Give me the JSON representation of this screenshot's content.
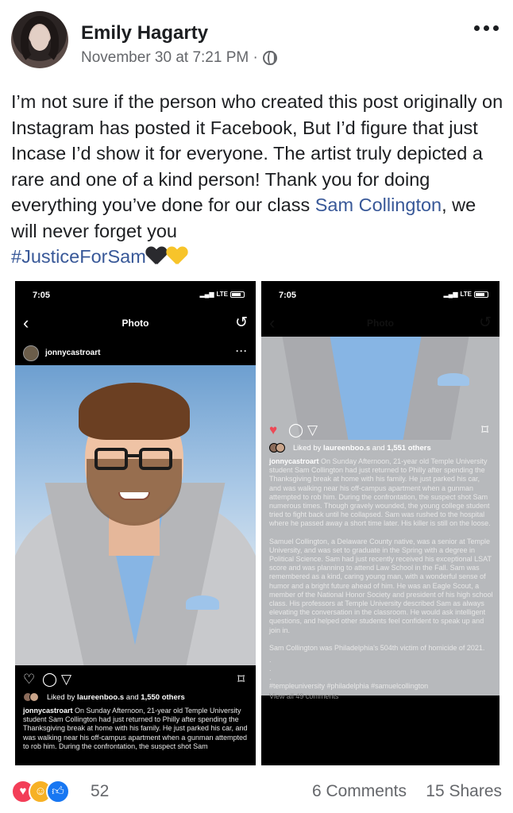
{
  "post": {
    "author": "Emily Hagarty",
    "timestamp": "November 30 at 7:21 PM ·",
    "privacy_icon": "globe-icon",
    "text_part1": "I’m not sure if the person who created this post originally on Instagram has posted it Facebook, But I’d figure that just Incase I’d show it for everyone. The artist truly depicted a rare and one of a kind person! Thank you for doing everything you’ve done for our class ",
    "mention": "Sam Collington",
    "text_part2": ", we will never forget you",
    "hashtag": "#JusticeForSam",
    "emojis": [
      "black-heart",
      "yellow-heart"
    ]
  },
  "screens": [
    {
      "time": "7:05",
      "signal": "LTE",
      "title": "Photo",
      "username": "jonnycastroart",
      "more": "···",
      "likes_prefix": "Liked by ",
      "likes_user": "laureenboo.s",
      "likes_mid": " and ",
      "likes_count": "1,550 others",
      "caption_handle": "jonnycastroart",
      "caption": " On Sunday Afternoon, 21-year old Temple University student Sam Collington had just returned to Philly after spending the Thanksgiving break at home with his family. He just parked his car, and was walking near his off-campus apartment when a gunman attempted to rob him. During the confrontation, the suspect shot Sam"
    },
    {
      "time": "7:05",
      "signal": "LTE",
      "title": "Photo",
      "likes_prefix": "Liked by ",
      "likes_user": "laureenboo.s",
      "likes_mid": " and ",
      "likes_count": "1,551 others",
      "caption_handle": "jonnycastroart",
      "caption_p1": " On Sunday Afternoon, 21-year old Temple University student Sam Collington had just returned to Philly after spending the Thanksgiving break at home with his family. He just parked his car, and was walking near his off-campus apartment when a gunman attempted to rob him. During the confrontation, the suspect shot Sam numerous times. Though gravely wounded, the young college student tried to fight back until he collapsed. Sam was rushed to the hospital where he passed away a short time later. His killer is still on the loose.",
      "caption_p2": "Samuel Collington, a Delaware County native, was a senior at Temple University, and was set to graduate in the Spring with a degree in Political Science. Sam had just recently received his exceptional LSAT score and was planning to attend Law School in the Fall. Sam was remembered as a kind, caring young man, with a wonderful sense of humor and a bright future ahead of him. He was an Eagle Scout, a member of the National Honor Society and president of his high school class. His professors at Temple University described Sam as always elevating the conversation in the classroom. He would ask intelligent questions, and helped other students feel confident to speak up and join in.",
      "caption_p3": "Sam Collington was Philadelphia's 504th victim of homicide of 2021.",
      "dots": [
        ".",
        ".",
        "."
      ],
      "tags": "#templeuniversity #philadelphia #samuelcollington",
      "view_all": "View all 49 comments"
    }
  ],
  "footer": {
    "reactions": [
      "love",
      "care",
      "like"
    ],
    "reaction_count": "52",
    "comments": "6 Comments",
    "shares": "15 Shares"
  }
}
